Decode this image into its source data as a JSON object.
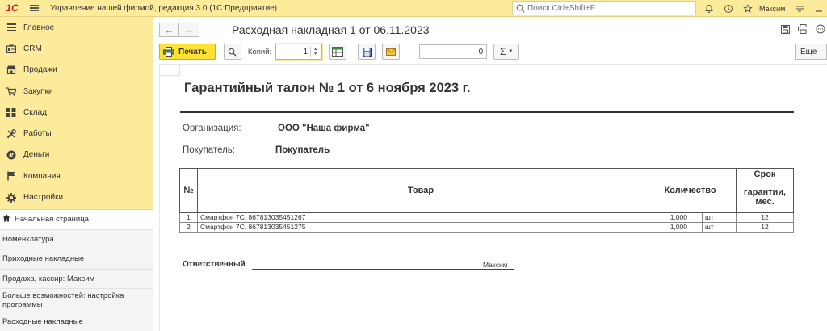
{
  "app": {
    "logo": "1C",
    "title": "Управление нашей фирмой, редакция 3.0  (1С:Предприятие)",
    "search_placeholder": "Поиск Ctrl+Shift+F",
    "user": "Максим"
  },
  "sidebar": {
    "sections": [
      {
        "label": "Главное",
        "icon": "menu-lines-icon"
      },
      {
        "label": "CRM",
        "icon": "crm-icon"
      },
      {
        "label": "Продажи",
        "icon": "shop-icon"
      },
      {
        "label": "Закупки",
        "icon": "cart-icon"
      },
      {
        "label": "Склад",
        "icon": "warehouse-icon"
      },
      {
        "label": "Работы",
        "icon": "tools-icon"
      },
      {
        "label": "Деньги",
        "icon": "coin-icon"
      },
      {
        "label": "Компания",
        "icon": "flag-icon"
      },
      {
        "label": "Настройки",
        "icon": "gear-icon"
      }
    ],
    "nav": [
      {
        "label": "Начальная страница"
      },
      {
        "label": "Номенклатура"
      },
      {
        "label": "Приходные накладные"
      },
      {
        "label": "Продажа, кассир: Максим"
      },
      {
        "label": "Больше возможностей: настройка программы"
      },
      {
        "label": "Расходные накладные"
      }
    ]
  },
  "document": {
    "title": "Расходная накладная 1 от 06.11.2023",
    "nav_back": "←",
    "nav_forward": "→"
  },
  "toolbar": {
    "print_label": "Печать",
    "copies_label": "Копий:",
    "copies_value": "1",
    "sum_value": "0",
    "sigma": "Σ",
    "more_label": "Еще"
  },
  "printform": {
    "heading": "Гарантийный талон № 1 от 6 ноября 2023 г.",
    "org_label": "Организация:",
    "org_value": "ООО \"Наша фирма\"",
    "buyer_label": "Покупатель:",
    "buyer_value": "Покупатель",
    "table": {
      "headers": {
        "num": "№",
        "product": "Товар",
        "qty": "Количество",
        "warranty_line1": "Срок",
        "warranty_line2": "гарантии,",
        "warranty_line3": "мес."
      },
      "rows": [
        {
          "num": "1",
          "product": "Смартфон 7С, 867813035451267",
          "qty": "1,000",
          "unit": "шт",
          "warranty": "12"
        },
        {
          "num": "2",
          "product": "Смартфон 7С, 867813035451275",
          "qty": "1,000",
          "unit": "шт",
          "warranty": "12"
        }
      ]
    },
    "responsible_label": "Ответственный",
    "responsible_name": "Максим"
  }
}
